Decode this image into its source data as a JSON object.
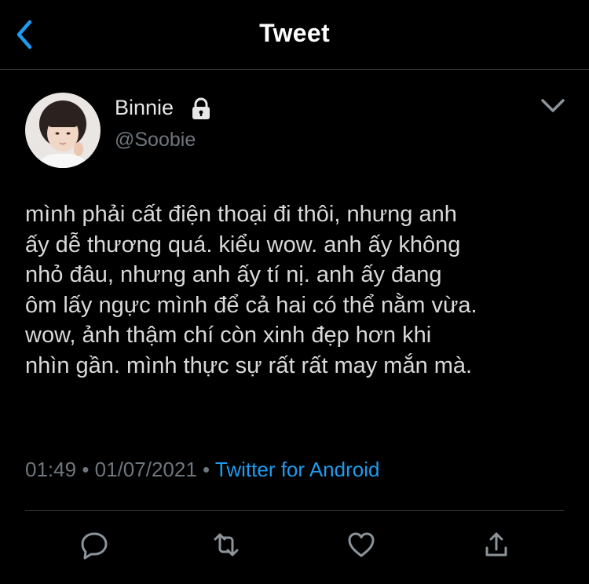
{
  "header": {
    "title": "Tweet",
    "back_icon": "chevron-left-icon"
  },
  "author": {
    "display_name": "Binnie",
    "handle": "@Soobie",
    "protected_icon": "lock-icon",
    "avatar_icon": "avatar-photo"
  },
  "menu_icon": "chevron-down-icon",
  "tweet": {
    "text": "mình phải cất điện thoại đi thôi, nhưng anh\nấy dễ thương quá. kiểu wow. anh ấy không\nnhỏ đâu, nhưng anh ấy tí nị. anh ấy đang\nôm lấy ngực mình để cả hai có thể nằm vừa.\nwow, ảnh thậm chí còn xinh đẹp hơn khi\nnhìn gần. mình thực sự rất rất may mắn mà.",
    "time": "01:49",
    "separator": "•",
    "date": "01/07/2021",
    "source": "Twitter for Android"
  },
  "actions": {
    "reply_icon": "reply-icon",
    "retweet_icon": "retweet-icon",
    "like_icon": "heart-icon",
    "share_icon": "share-icon"
  },
  "colors": {
    "background": "#000000",
    "accent": "#1d9bf0",
    "muted": "#6e767d",
    "text": "#d9d9d9",
    "divider": "#2f3336"
  }
}
